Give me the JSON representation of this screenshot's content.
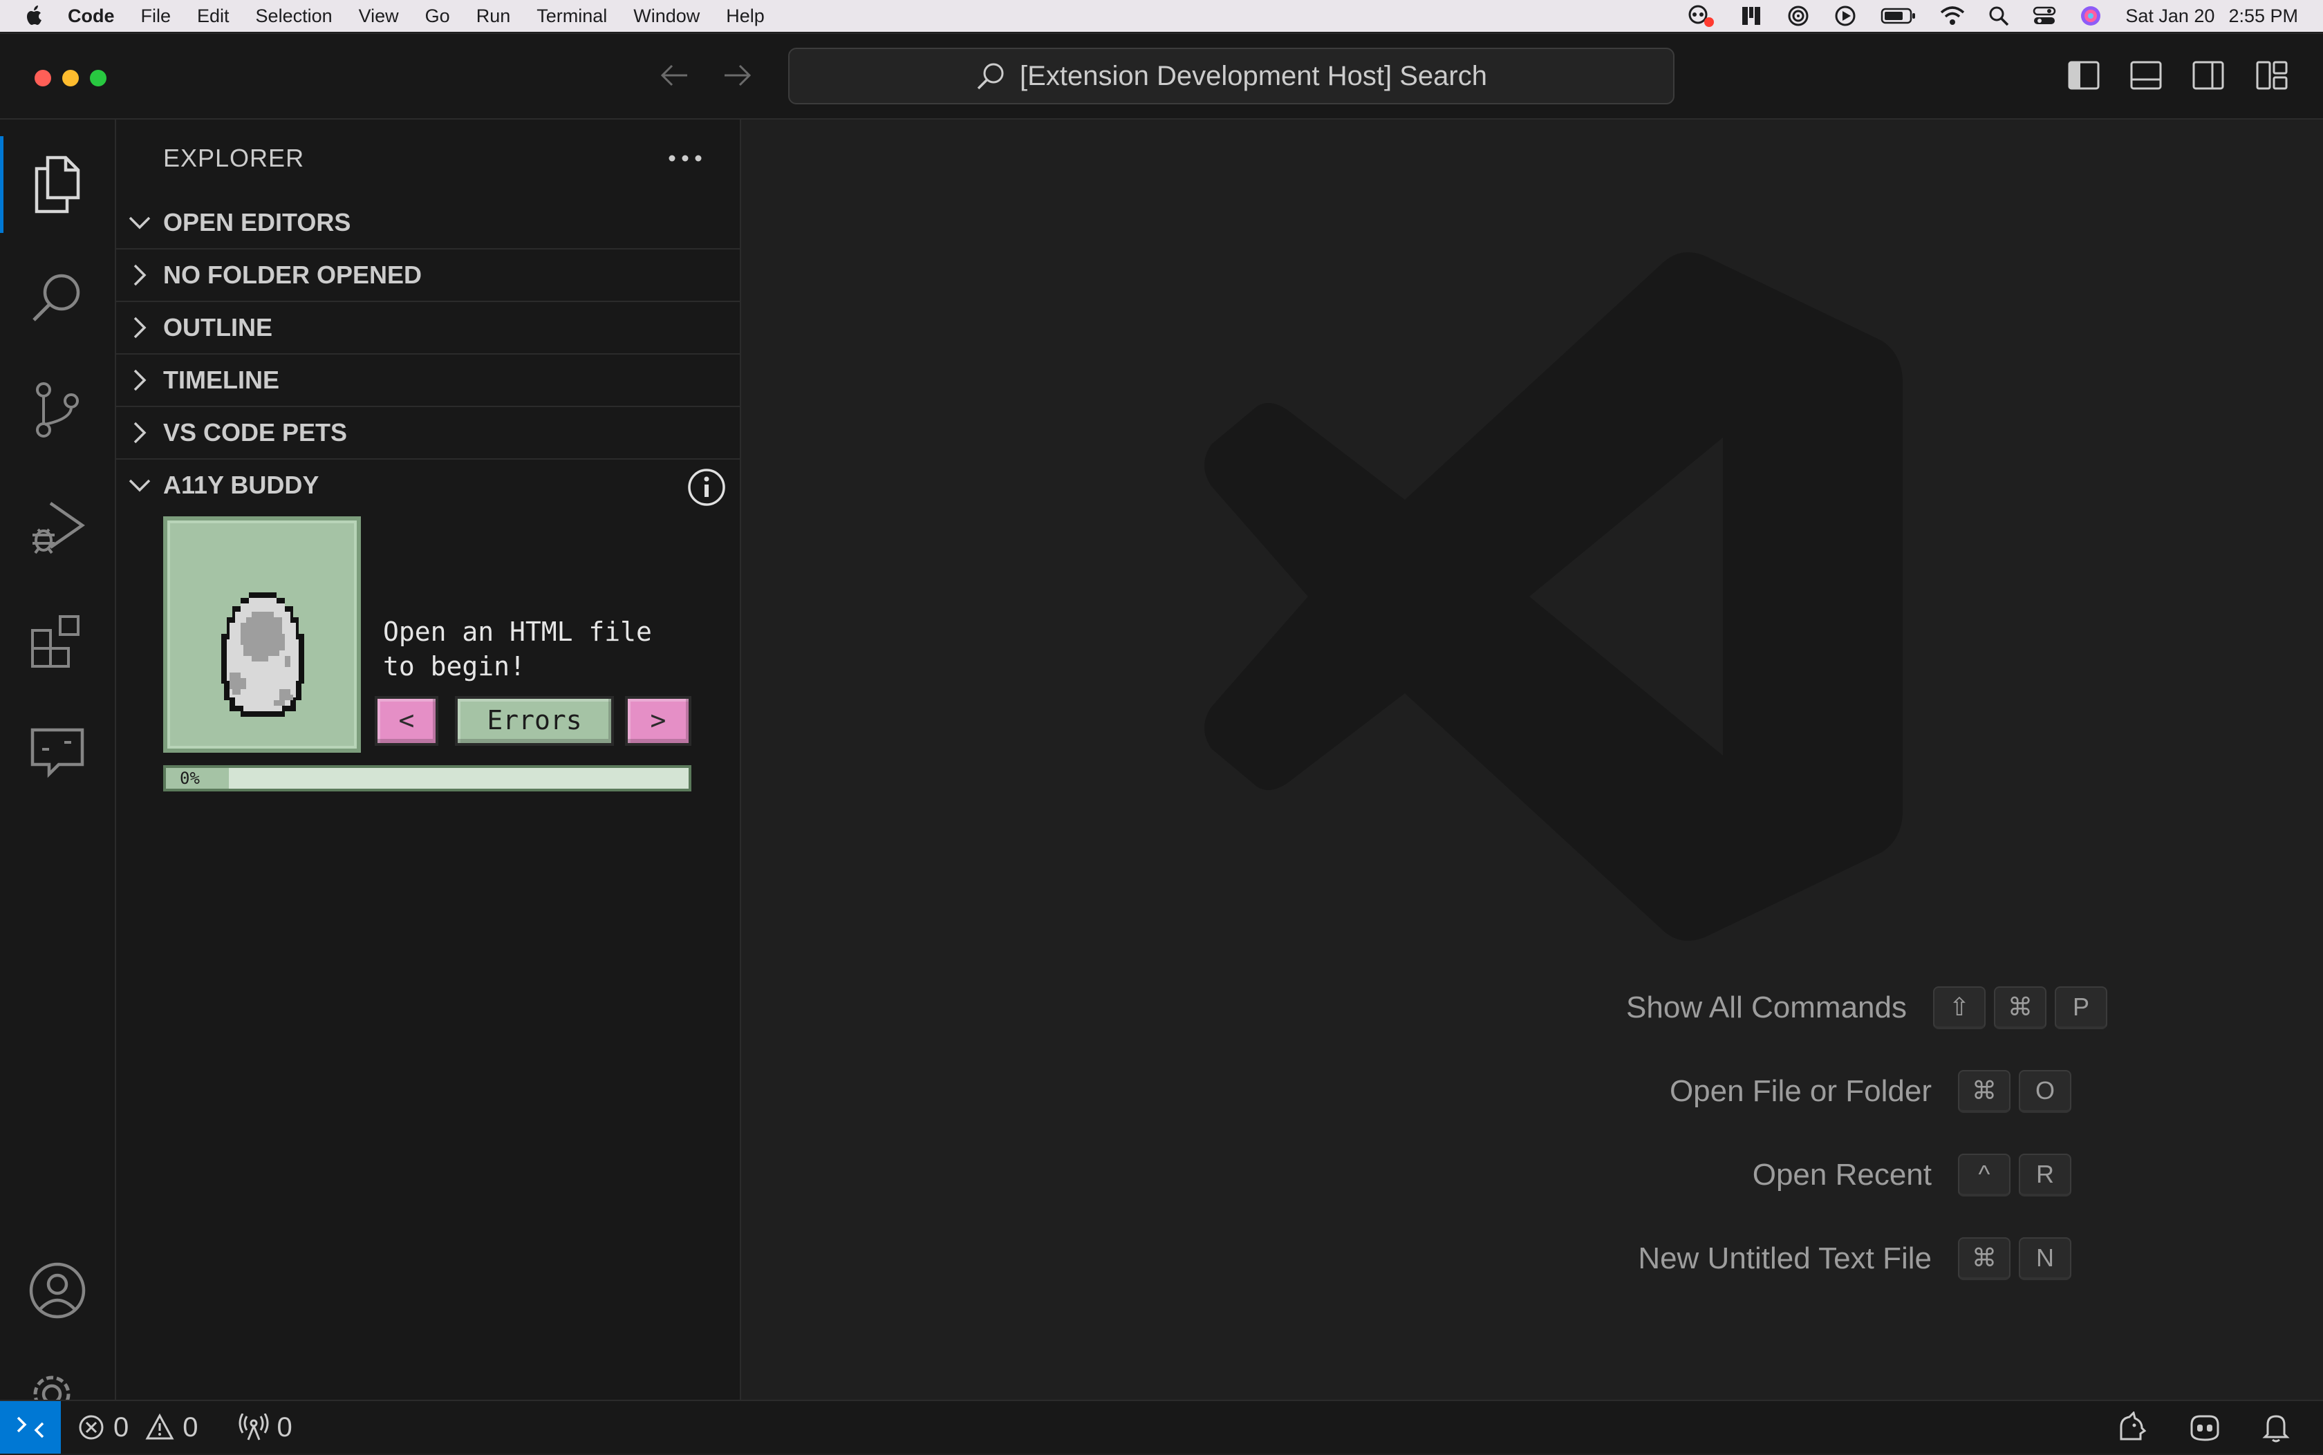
{
  "menubar": {
    "app_name": "Code",
    "menus": [
      "File",
      "Edit",
      "Selection",
      "View",
      "Go",
      "Run",
      "Terminal",
      "Window",
      "Help"
    ],
    "date": "Sat Jan 20",
    "time": "2:55 PM"
  },
  "titlebar": {
    "search_text": "[Extension Development Host] Search"
  },
  "sidebar": {
    "title": "EXPLORER",
    "sections": {
      "open_editors": "OPEN EDITORS",
      "no_folder": "NO FOLDER OPENED",
      "outline": "OUTLINE",
      "timeline": "TIMELINE",
      "pets": "VS CODE PETS",
      "buddy": "A11Y BUDDY"
    },
    "buddy": {
      "message_line1": "Open an HTML file",
      "message_line2": "to begin!",
      "prev_label": "<",
      "mode_label": "Errors",
      "next_label": ">",
      "progress_label": "0%",
      "progress": 0.12
    }
  },
  "editor": {
    "shortcuts": [
      {
        "label": "Show All Commands",
        "keys": [
          "⇧",
          "⌘",
          "P"
        ]
      },
      {
        "label": "Open File or Folder",
        "keys": [
          "⌘",
          "O"
        ]
      },
      {
        "label": "Open Recent",
        "keys": [
          "^",
          "R"
        ]
      },
      {
        "label": "New Untitled Text File",
        "keys": [
          "⌘",
          "N"
        ]
      }
    ]
  },
  "statusbar": {
    "errors": "0",
    "warnings": "0",
    "ports": "0"
  },
  "colors": {
    "accent": "#0078d4",
    "pet_green": "#a5c3a5",
    "button_pink": "#e58fc6"
  }
}
